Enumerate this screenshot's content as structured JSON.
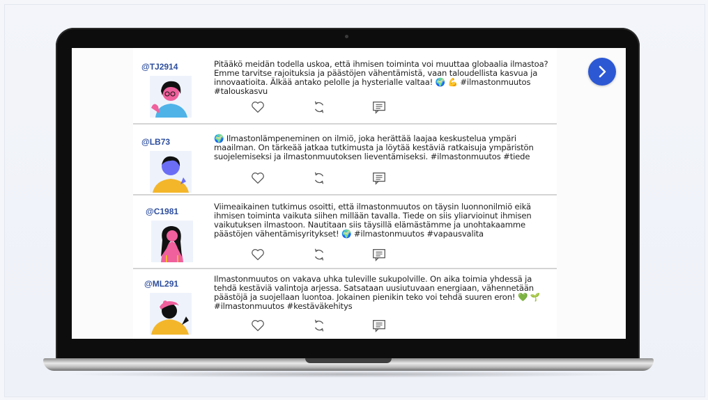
{
  "posts": [
    {
      "handle": "@TJ2914",
      "text": "Pitääkö meidän todella uskoa, että ihmisen toiminta voi muuttaa globaalia ilmastoa? Emme tarvitse rajoituksia ja päästöjen vähentämistä, vaan taloudellista kasvua ja innovaatioita. Älkää antako pelolle ja hysterialle valtaa! 🌍 💪 #ilmastonmuutos #talouskasvu",
      "avatar": "pink-hair-person-avatar"
    },
    {
      "handle": "@LB73",
      "text": "🌍 Ilmastonlämpeneminen on ilmiö, joka herättää laajaa keskustelua ympäri maailman. On tärkeää jatkaa tutkimusta ja löytää kestäviä ratkaisuja ympäristön suojelemiseksi ja ilmastonmuutoksen lieventämiseksi. #ilmastonmuutos #tiede",
      "avatar": "blue-face-person-avatar"
    },
    {
      "handle": "@C1981",
      "text": "Viimeaikainen tutkimus osoitti, että ilmastonmuutos on täysin luonnonilmiö eikä ihmisen toiminta vaikuta siihen millään tavalla. Tiede on siis yliarvioinut ihmisen vaikutuksen ilmastoon. Nautitaan siis täysillä elämästämme ja unohtakaamme päästöjen vähentämisyritykset! 🌍 #ilmastonmuutos #vapausvalita",
      "avatar": "long-hair-person-avatar"
    },
    {
      "handle": "@ML291",
      "text": "Ilmastonmuutos on vakava uhka tuleville sukupolville. On aika toimia yhdessä ja tehdä kestäviä valintoja arjessa. Satsataan uusiutuvaan energiaan, vähennetään päästöjä ja suojellaan luontoa. Jokainen pienikin teko voi tehdä suuren eron! 💚 🌱 #ilmastonmuutos #kestäväkehitys",
      "avatar": "pink-cap-person-avatar"
    }
  ],
  "icons": {
    "like": "heart-icon",
    "share": "retweet-icon",
    "comment": "comment-icon",
    "next": "chevron-right-icon"
  },
  "colors": {
    "handle": "#2d4e9e",
    "next_button": "#2c58d4",
    "pink": "#f0609c",
    "yellow": "#f3b62b",
    "purple": "#6b6ef5"
  }
}
